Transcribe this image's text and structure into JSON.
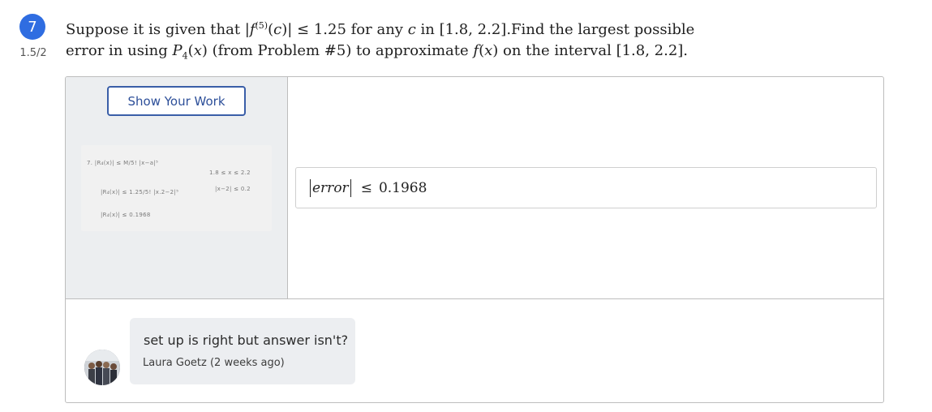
{
  "question": {
    "number": "7",
    "score": "1.5/2",
    "line1": {
      "t1": "Suppose it is given that |",
      "f": "f",
      "sup": "(5)",
      "t2": "(",
      "c": "c",
      "t3": ")| ≤ 1.25 for any ",
      "c2": "c",
      "t4": " in [1.8, 2.2].Find the largest possible"
    },
    "line2": {
      "t1": "error in using ",
      "P": "P",
      "sub": "4",
      "t2": "(",
      "x": "x",
      "t3": ") (from Problem #5) to approximate ",
      "f": "f",
      "t4": "(",
      "x2": "x",
      "t5": ") on the interval [1.8, 2.2]."
    }
  },
  "work": {
    "button_label": "Show Your Work",
    "handwriting": {
      "l1": "7.  |R₄(x)| ≤  M/5!  |x−a|⁵",
      "l2": "|R₄(x)| ≤  1.25/5!  |x.2−2|⁵",
      "l3": "|R₄(x)| ≤ 0.1968",
      "r1": "1.8 ≤ x ≤ 2.2",
      "r2": "|x−2| ≤ 0.2"
    }
  },
  "answer": {
    "word": "error",
    "symbol": "≤",
    "value": "0.1968"
  },
  "comment": {
    "text": "set up is right but answer isn't?",
    "author": "Laura Goetz (2 weeks ago)"
  },
  "colors": {
    "badge": "#2f6de1",
    "button_border": "#3a5ea8",
    "panel_bg": "#eceef0",
    "comment_bg": "#eceef1"
  }
}
